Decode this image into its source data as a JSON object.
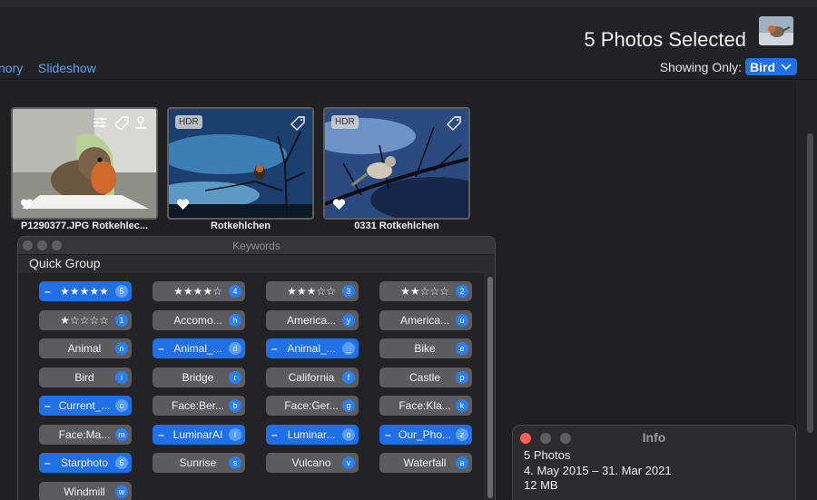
{
  "header": {
    "selected_count": "5 Photos Selected",
    "nav": [
      "nory",
      "Slideshow"
    ],
    "showing_label": "Showing Only:",
    "showing_value": "Bird"
  },
  "photos": [
    {
      "caption": "P1290377.JPG Rotkehlec...",
      "hdr": ""
    },
    {
      "caption": "Rotkehlchen",
      "hdr": "HDR"
    },
    {
      "caption": "0331 Rotkehlchen",
      "hdr": "HDR"
    }
  ],
  "keywords_panel": {
    "title": "Keywords",
    "group": "Quick Group",
    "items": [
      {
        "label": "★★★★★",
        "key": "5",
        "on": true
      },
      {
        "label": "★★★★☆",
        "key": "4",
        "on": false
      },
      {
        "label": "★★★☆☆",
        "key": "3",
        "on": false
      },
      {
        "label": "★★☆☆☆",
        "key": "2",
        "on": false
      },
      {
        "label": "★☆☆☆☆",
        "key": "1",
        "on": false
      },
      {
        "label": "Accomo...",
        "key": "h",
        "on": false
      },
      {
        "label": "America...",
        "key": "y",
        "on": false
      },
      {
        "label": "America...",
        "key": "u",
        "on": false
      },
      {
        "label": "Animal",
        "key": "n",
        "on": false
      },
      {
        "label": "Animal_...",
        "key": "d",
        "on": true
      },
      {
        "label": "Animal_...",
        "key": "_",
        "on": true
      },
      {
        "label": "Bike",
        "key": "e",
        "on": false
      },
      {
        "label": "Bird",
        "key": "i",
        "on": false
      },
      {
        "label": "Bridge",
        "key": "r",
        "on": false
      },
      {
        "label": "California",
        "key": "f",
        "on": false
      },
      {
        "label": "Castle",
        "key": "p",
        "on": false
      },
      {
        "label": "Current_...",
        "key": "c",
        "on": true
      },
      {
        "label": "Face:Ber...",
        "key": "b",
        "on": false
      },
      {
        "label": "Face:Ger...",
        "key": "g",
        "on": false
      },
      {
        "label": "Face:Kla...",
        "key": "k",
        "on": false
      },
      {
        "label": "Face:Ma...",
        "key": "m",
        "on": false
      },
      {
        "label": "LuminarAI",
        "key": "l",
        "on": true
      },
      {
        "label": "Luminar...",
        "key": "o",
        "on": true
      },
      {
        "label": "Our_Pho...",
        "key": "z",
        "on": true
      },
      {
        "label": "Starphoto",
        "key": "6",
        "on": true
      },
      {
        "label": "Sunrise",
        "key": "s",
        "on": false
      },
      {
        "label": "Vulcano",
        "key": "v",
        "on": false
      },
      {
        "label": "Waterfall",
        "key": "a",
        "on": false
      },
      {
        "label": "Windmill",
        "key": "w",
        "on": false
      }
    ]
  },
  "info_panel": {
    "title": "Info",
    "count": "5 Photos",
    "dates": "4. May 2015 – 31. Mar 2021",
    "size": "12 MB"
  },
  "colors": {
    "accent": "#1f6fe6",
    "link": "#5aa0f7",
    "close_dot": "#ff5f57"
  }
}
